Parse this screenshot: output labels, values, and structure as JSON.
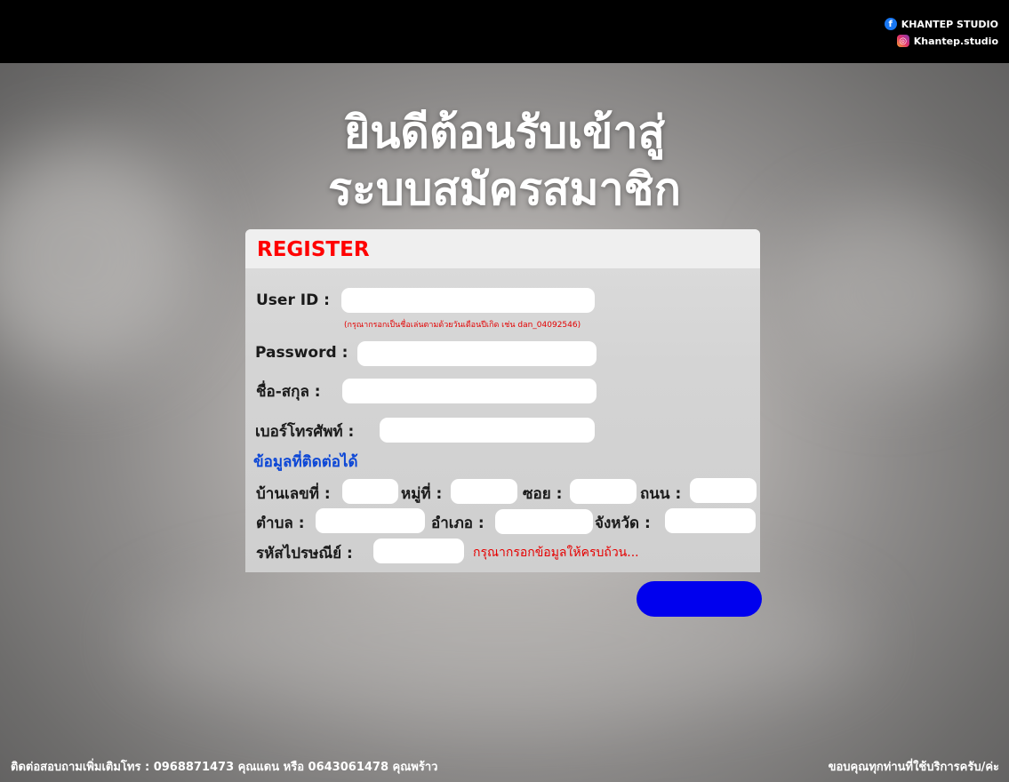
{
  "header": {
    "facebook_label": "KHANTEP STUDIO",
    "instagram_label": "Khantep.studio",
    "facebook_icon": "facebook-icon",
    "instagram_icon": "instagram-icon"
  },
  "title": {
    "line1": "ยินดีต้อนรับเข้าสู่",
    "line2": "ระบบสมัครสมาชิก"
  },
  "form": {
    "heading": "REGISTER",
    "user_id_label": "User ID :",
    "user_id_value": "",
    "user_id_hint": "(กรุณากรอกเป็นชื่อเล่นตามด้วยวันเดือนปีเกิด เช่น dan_04092546)",
    "password_label": "Password :",
    "password_value": "",
    "fullname_label": "ชื่อ-สกุล :",
    "fullname_value": "",
    "phone_label": "เบอร์โทรศัพท์ :",
    "phone_value": "",
    "contact_section": "ข้อมูลที่ติดต่อได้",
    "house_no_label": "บ้านเลขที่ :",
    "moo_label": "หมู่ที่ :",
    "soi_label": "ซอย :",
    "road_label": "ถนน :",
    "subdistrict_label": "ตำบล :",
    "district_label": "อำเภอ :",
    "province_label": "จังหวัด :",
    "postcode_label": "รหัสไปรษณีย์ :",
    "required_note": "กรุณากรอกข้อมูลให้ครบถ้วน..."
  },
  "submit": {
    "label": "",
    "color": "#0000ee"
  },
  "footer": {
    "contact": "ติดต่อสอบถามเพิ่มเติมโทร : 0968871473 คุณแดน หรือ 0643061478 คุณพร้าว",
    "thanks": "ขอบคุณทุกท่านที่ใช้บริการครับ/ค่ะ"
  },
  "colors": {
    "heading": "#ff0000",
    "section": "#0b46d6",
    "topbar": "#000000"
  }
}
